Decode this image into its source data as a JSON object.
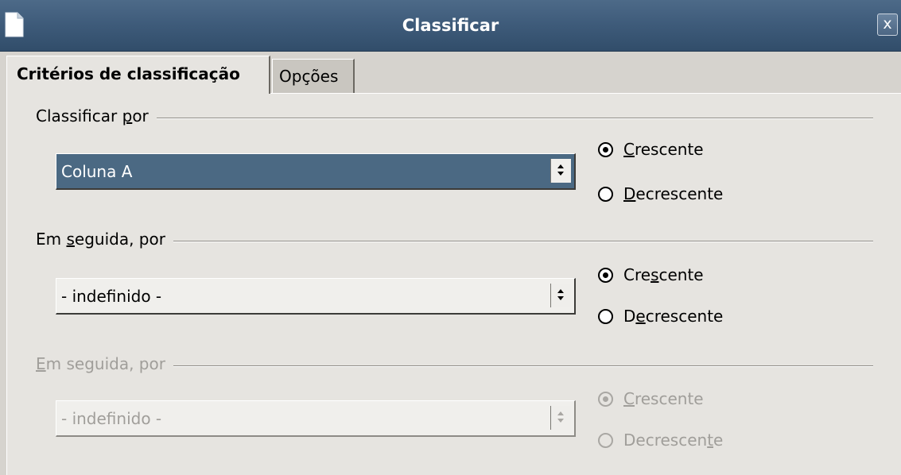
{
  "window": {
    "title": "Classificar",
    "close_symbol": "x"
  },
  "tabs": [
    {
      "label": "Critérios de classificação",
      "active": true
    },
    {
      "label": "Opções",
      "active": false
    }
  ],
  "sections": [
    {
      "heading_before": "Classificar ",
      "heading_mnemonic": "p",
      "heading_after": "or",
      "combo_value": "Coluna A",
      "enabled": true,
      "selected": true,
      "asc": {
        "before": "",
        "mnemonic": "C",
        "after": "rescente",
        "checked": true
      },
      "desc": {
        "before": "",
        "mnemonic": "D",
        "after": "ecrescente",
        "checked": false
      }
    },
    {
      "heading_before": "Em ",
      "heading_mnemonic": "s",
      "heading_after": "eguida, por",
      "combo_value": "- indefinido -",
      "enabled": true,
      "selected": false,
      "asc": {
        "before": "Cre",
        "mnemonic": "s",
        "after": "cente",
        "checked": true
      },
      "desc": {
        "before": "D",
        "mnemonic": "e",
        "after": "crescente",
        "checked": false
      }
    },
    {
      "heading_before": "",
      "heading_mnemonic": "E",
      "heading_after": "m seguida, por",
      "combo_value": "- indefinido -",
      "enabled": false,
      "selected": false,
      "asc": {
        "before": "",
        "mnemonic": "C",
        "after": "rescente",
        "checked": true
      },
      "desc": {
        "before": "Decrescen",
        "mnemonic": "t",
        "after": "e",
        "checked": false
      }
    }
  ],
  "icons": {
    "window_icon": "document-icon",
    "close": "close-icon",
    "spinner": "up-down-arrows-icon"
  },
  "colors": {
    "titlebar": "#3f5c7b",
    "selection": "#4b6983",
    "background": "#d6d3ce",
    "disabled_text": "#a09e9a"
  }
}
